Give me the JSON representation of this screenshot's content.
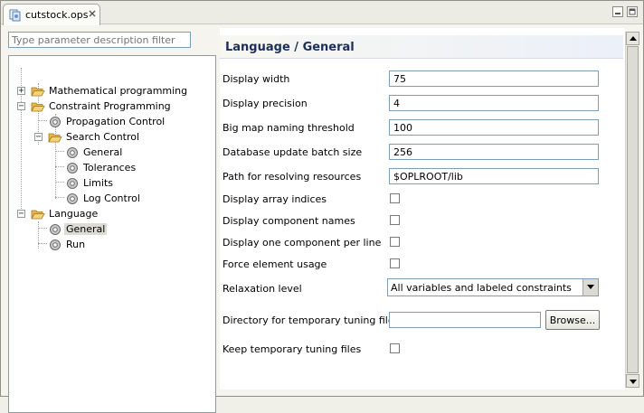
{
  "tab": {
    "title": "cutstock.ops"
  },
  "filter": {
    "placeholder": "Type parameter description filter"
  },
  "tree": {
    "mathematical_programming": "Mathematical programming",
    "constraint_programming": "Constraint Programming",
    "propagation_control": "Propagation Control",
    "search_control": "Search Control",
    "general_search": "General",
    "tolerances": "Tolerances",
    "limits": "Limits",
    "log_control": "Log Control",
    "language": "Language",
    "general_language": "General",
    "run": "Run"
  },
  "page": {
    "title": "Language / General",
    "fields": {
      "display_width": {
        "label": "Display width",
        "value": "75"
      },
      "display_precision": {
        "label": "Display precision",
        "value": "4"
      },
      "big_map": {
        "label": "Big map naming threshold",
        "value": "100"
      },
      "db_batch": {
        "label": "Database update batch size",
        "value": "256"
      },
      "path_resources": {
        "label": "Path for resolving resources",
        "value": "$OPLROOT/lib"
      },
      "array_indices": {
        "label": "Display array indices",
        "checked": false
      },
      "component_names": {
        "label": "Display component names",
        "checked": false
      },
      "one_component": {
        "label": "Display one component per line",
        "checked": false
      },
      "force_element": {
        "label": "Force element usage",
        "checked": false
      },
      "relaxation": {
        "label": "Relaxation level",
        "value": "All variables and labeled constraints"
      },
      "temp_dir": {
        "label": "Directory for temporary tuning files",
        "value": "",
        "button": "Browse..."
      },
      "keep_temp": {
        "label": "Keep temporary tuning files",
        "checked": false
      }
    }
  },
  "colors": {
    "title_text": "#1c2f5a",
    "folder": "#f2c45a",
    "selection": "#dcdbd4"
  },
  "icons": {
    "tab": "ops-file-icon",
    "close": "close-icon",
    "folder": "folder-open-icon",
    "node": "gear-icon",
    "minimize": "minimize-icon",
    "maximize": "maximize-icon"
  }
}
